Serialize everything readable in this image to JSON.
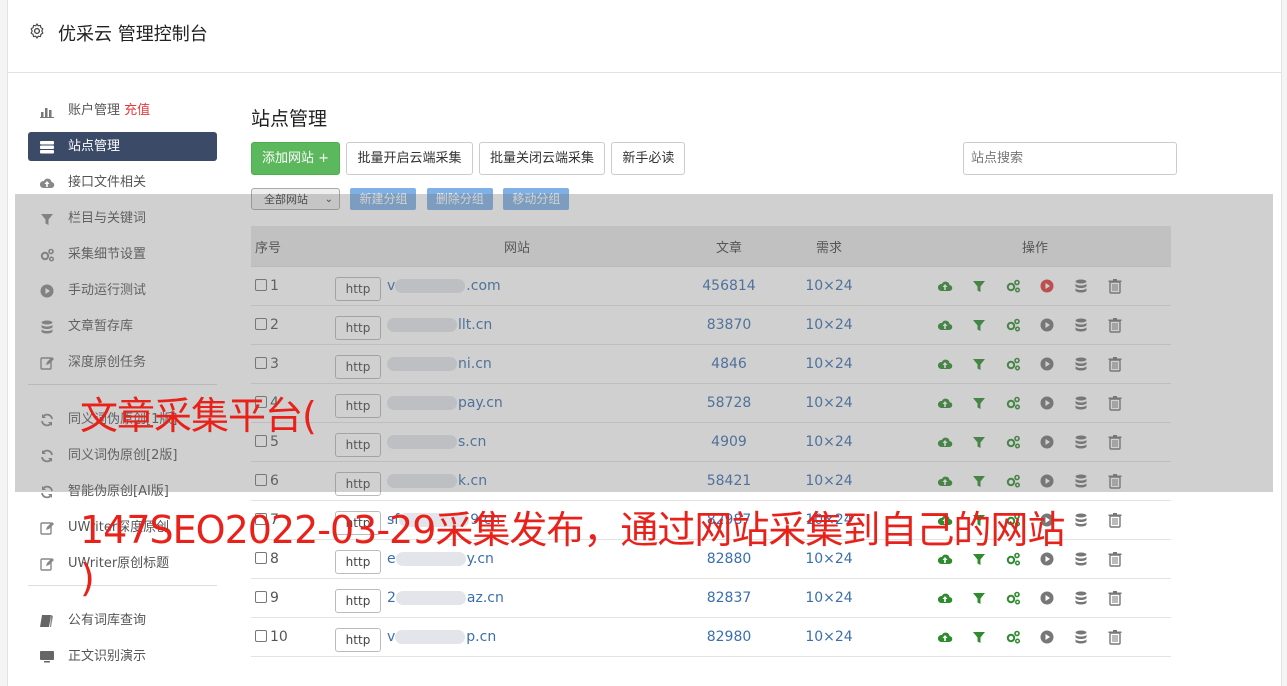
{
  "header": {
    "title": "优采云 管理控制台",
    "icon": "gear-icon"
  },
  "sidebar": {
    "items": [
      {
        "label": "账户管理",
        "extra": "充值",
        "icon": "bar-chart-icon"
      },
      {
        "label": "站点管理",
        "icon": "server-icon",
        "active": true
      },
      {
        "label": "接口文件相关",
        "icon": "cloud-upload-icon"
      },
      {
        "label": "栏目与关键词",
        "icon": "filter-icon"
      },
      {
        "label": "采集细节设置",
        "icon": "cogs-icon"
      },
      {
        "label": "手动运行测试",
        "icon": "play-circle-icon"
      },
      {
        "label": "文章暂存库",
        "icon": "database-icon"
      },
      {
        "label": "深度原创任务",
        "icon": "edit-icon"
      }
    ],
    "items2": [
      {
        "label": "同义词伪原创[1版]",
        "icon": "refresh-icon"
      },
      {
        "label": "同义词伪原创[2版]",
        "icon": "refresh-icon"
      },
      {
        "label": "智能伪原创[AI版]",
        "icon": "refresh-icon"
      },
      {
        "label": "UWriter深度原创",
        "icon": "edit-icon"
      },
      {
        "label": "UWriter原创标题",
        "icon": "edit-icon"
      }
    ],
    "items3": [
      {
        "label": "公有词库查询",
        "icon": "book-icon"
      },
      {
        "label": "正文识别演示",
        "icon": "monitor-icon"
      }
    ]
  },
  "main": {
    "title": "站点管理",
    "toolbar": {
      "add": "添加网站 +",
      "batch_on": "批量开启云端采集",
      "batch_off": "批量关闭云端采集",
      "newbie": "新手必读",
      "search_placeholder": "站点搜索"
    },
    "group": {
      "select": "全部网站",
      "new": "新建分组",
      "delete": "删除分组",
      "move": "移动分组"
    },
    "table": {
      "headers": [
        "序号",
        "网站",
        "文章",
        "需求",
        "操作"
      ],
      "rows": [
        {
          "no": "1",
          "protocol": "http",
          "site_pre": "v",
          "site": ".com",
          "articles": "456814",
          "demand": "10×24",
          "running": true
        },
        {
          "no": "2",
          "protocol": "http",
          "site_pre": "",
          "site": "llt.cn",
          "articles": "83870",
          "demand": "10×24",
          "running": false
        },
        {
          "no": "3",
          "protocol": "http",
          "site_pre": "",
          "site": "ni.cn",
          "articles": "4846",
          "demand": "10×24",
          "running": false
        },
        {
          "no": "4",
          "protocol": "http",
          "site_pre": "",
          "site": "pay.cn",
          "articles": "58728",
          "demand": "10×24",
          "running": false
        },
        {
          "no": "5",
          "protocol": "http",
          "site_pre": "",
          "site": "s.cn",
          "articles": "4909",
          "demand": "10×24",
          "running": false
        },
        {
          "no": "6",
          "protocol": "http",
          "site_pre": "",
          "site": "k.cn",
          "articles": "58421",
          "demand": "10×24",
          "running": false
        },
        {
          "no": "7",
          "protocol": "http",
          "site_pre": "sf",
          "site": "9.cn",
          "articles": "82987",
          "demand": "10×24",
          "running": false
        },
        {
          "no": "8",
          "protocol": "http",
          "site_pre": "e",
          "site": "y.cn",
          "articles": "82880",
          "demand": "10×24",
          "running": false
        },
        {
          "no": "9",
          "protocol": "http",
          "site_pre": "2",
          "site": "az.cn",
          "articles": "82837",
          "demand": "10×24",
          "running": false
        },
        {
          "no": "10",
          "protocol": "http",
          "site_pre": "v",
          "site": "p.cn",
          "articles": "82980",
          "demand": "10×24",
          "running": false
        }
      ]
    }
  },
  "watermark": {
    "line1": "文章采集平台(",
    "line2": "147SEO2022-03-29采集发布，通过网站采集到自己的网站",
    "line3": ")"
  },
  "colors": {
    "active_nav": "#3b4a67",
    "green_button": "#5cb85c",
    "group_button": "#7fb1e6",
    "link_blue": "#3a6fae",
    "watermark_red": "#e8211a",
    "run_red": "#e4393c",
    "op_green": "#2e8b2e"
  }
}
